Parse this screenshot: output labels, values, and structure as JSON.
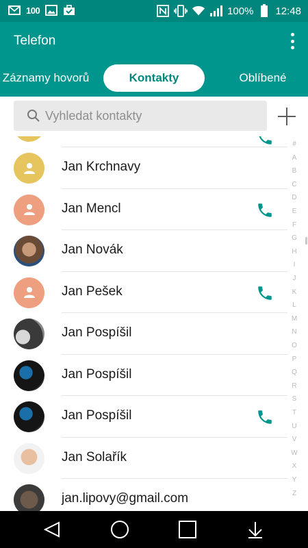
{
  "status_bar": {
    "notification_badge": "100",
    "battery_percent": "100%",
    "time": "12:48",
    "icons": [
      "email-icon",
      "image-icon",
      "briefcase-check-icon",
      "nfc-icon",
      "vibrate-icon",
      "wifi-icon",
      "signal-icon",
      "battery-icon"
    ]
  },
  "app_bar": {
    "title": "Telefon",
    "menu_icon": "more-vert-icon"
  },
  "tabs": [
    {
      "label": "Záznamy hovorů",
      "active": false
    },
    {
      "label": "Kontakty",
      "active": true
    },
    {
      "label": "Oblíbené",
      "active": false
    }
  ],
  "search": {
    "placeholder": "Vyhledat kontakty",
    "value": ""
  },
  "contacts": [
    {
      "name": "Jan Krchnavy",
      "avatar": "placeholder-yellow",
      "has_call": false
    },
    {
      "name": "Jan Mencl",
      "avatar": "placeholder-salmon",
      "has_call": true
    },
    {
      "name": "Jan Novák",
      "avatar": "photo",
      "has_call": false
    },
    {
      "name": "Jan Pešek",
      "avatar": "placeholder-salmon",
      "has_call": true
    },
    {
      "name": "Jan Pospíšil",
      "avatar": "photo",
      "has_call": false
    },
    {
      "name": "Jan Pospíšil",
      "avatar": "photo",
      "has_call": false
    },
    {
      "name": "Jan Pospíšil",
      "avatar": "photo",
      "has_call": true
    },
    {
      "name": "Jan Solařík",
      "avatar": "photo",
      "has_call": false
    },
    {
      "name": "jan.lipovy@gmail.com",
      "avatar": "photo",
      "has_call": false
    }
  ],
  "index_letters": [
    "#",
    "A",
    "B",
    "C",
    "D",
    "E",
    "F",
    "G",
    "H",
    "I",
    "J",
    "K",
    "L",
    "M",
    "N",
    "O",
    "P",
    "Q",
    "R",
    "S",
    "T",
    "U",
    "V",
    "W",
    "X",
    "Y",
    "Z"
  ],
  "colors": {
    "primary": "#00968d",
    "primary_dark": "#00867d",
    "call_icon": "#00968d",
    "navbar": "#000000"
  }
}
